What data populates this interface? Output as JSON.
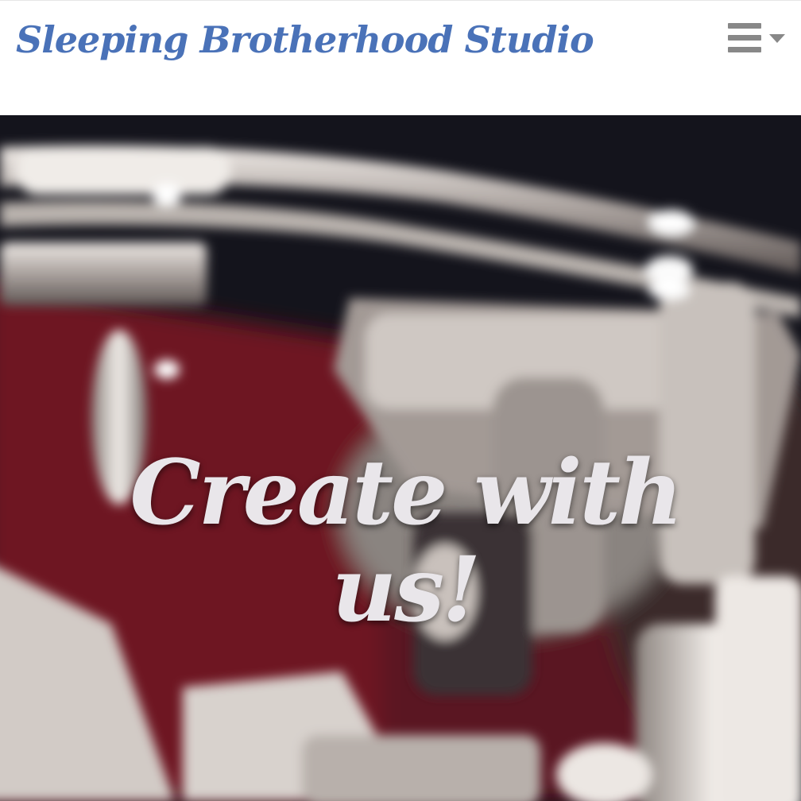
{
  "navbar": {
    "brand": "Sleeping Brotherhood Studio",
    "brand_color": "#4a72b8",
    "menu_icon": "hamburger-menu-icon"
  },
  "hero": {
    "title": "Create with us!",
    "background": "blurred close-up of a drum kit (red shell, chrome hardware)"
  }
}
